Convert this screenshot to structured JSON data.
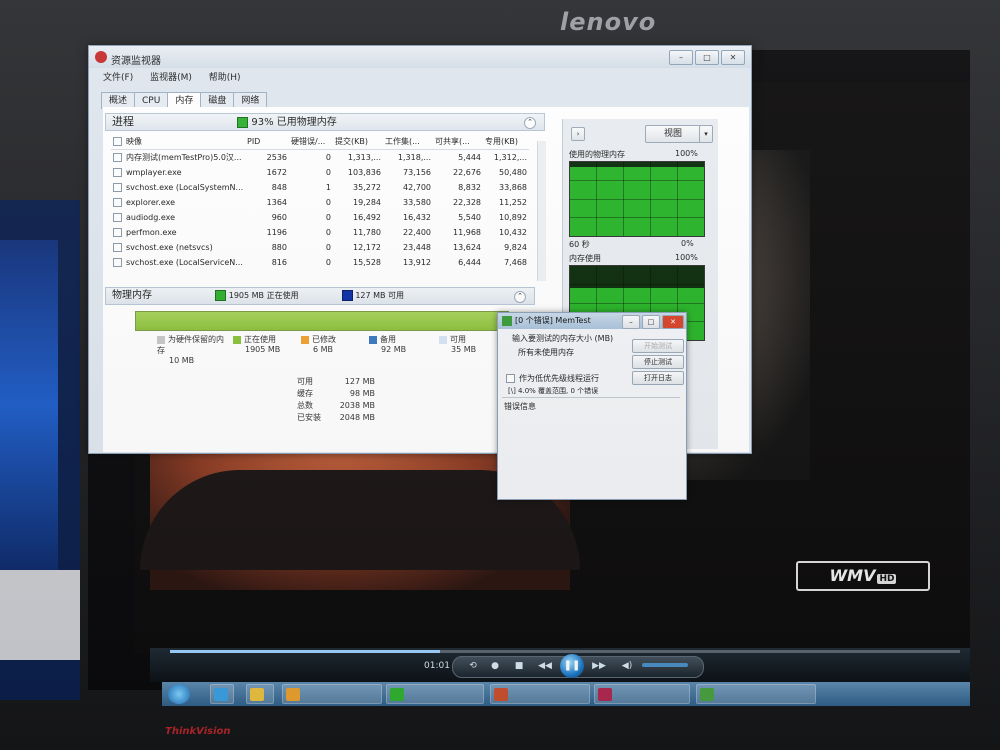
{
  "monitor": {
    "brand": "lenovo",
    "model": "ThinkVision"
  },
  "resmon": {
    "title": "资源监视器",
    "menu": [
      "文件(F)",
      "监视器(M)",
      "帮助(H)"
    ],
    "tabs": [
      "概述",
      "CPU",
      "内存",
      "磁盘",
      "网络"
    ],
    "active_tab": "内存",
    "process_section": {
      "title": "进程",
      "summary": "93% 已用物理内存",
      "columns": [
        "映像",
        "PID",
        "硬错误/...",
        "提交(KB)",
        "工作集(...",
        "可共享(...",
        "专用(KB)"
      ],
      "rows": [
        [
          "内存测试(memTestPro)5.0汉...",
          "2536",
          "0",
          "1,313,...",
          "1,318,...",
          "5,444",
          "1,312,..."
        ],
        [
          "wmplayer.exe",
          "1672",
          "0",
          "103,836",
          "73,156",
          "22,676",
          "50,480"
        ],
        [
          "svchost.exe (LocalSystemN...",
          "848",
          "1",
          "35,272",
          "42,700",
          "8,832",
          "33,868"
        ],
        [
          "explorer.exe",
          "1364",
          "0",
          "19,284",
          "33,580",
          "22,328",
          "11,252"
        ],
        [
          "audiodg.exe",
          "960",
          "0",
          "16,492",
          "16,432",
          "5,540",
          "10,892"
        ],
        [
          "perfmon.exe",
          "1196",
          "0",
          "11,780",
          "22,400",
          "11,968",
          "10,432"
        ],
        [
          "svchost.exe (netsvcs)",
          "880",
          "0",
          "12,172",
          "23,448",
          "13,624",
          "9,824"
        ],
        [
          "svchost.exe (LocalServiceN...",
          "816",
          "0",
          "15,528",
          "13,912",
          "6,444",
          "7,468"
        ]
      ]
    },
    "physical_section": {
      "title": "物理内存",
      "in_use": "1905 MB 正在使用",
      "available": "127 MB 可用",
      "legend": [
        {
          "label": "为硬件保留的内存",
          "value": "10 MB",
          "color": "#c8c8c8"
        },
        {
          "label": "正在使用",
          "value": "1905 MB",
          "color": "#8bc03a"
        },
        {
          "label": "已修改",
          "value": "6 MB",
          "color": "#f0a030"
        },
        {
          "label": "备用",
          "value": "92 MB",
          "color": "#3a78c0"
        },
        {
          "label": "可用",
          "value": "35 MB",
          "color": "#d8e4f4"
        }
      ],
      "stats": [
        {
          "label": "可用",
          "value": "127 MB"
        },
        {
          "label": "缓存",
          "value": "98 MB"
        },
        {
          "label": "总数",
          "value": "2038 MB"
        },
        {
          "label": "已安装",
          "value": "2048 MB"
        }
      ]
    },
    "side_panel": {
      "view_label": "视图",
      "graph1_title": "使用的物理内存",
      "graph1_max": "100%",
      "graph1_time": "60 秒",
      "graph1_min": "0%",
      "graph2_title": "内存使用",
      "graph2_max": "100%"
    }
  },
  "memtest": {
    "title": "[0 个错误] MemTest",
    "prompt": "输入要测试的内存大小 (MB)",
    "value": "所有未使用内存",
    "btn_start": "开始测试",
    "btn_stop": "停止测试",
    "btn_log": "打开日志",
    "low_priority": "作为低优先级线程运行",
    "progress": "[\\]  4.0% 覆盖范围, 0 个错误",
    "error_label": "错误信息"
  },
  "player": {
    "time": "01:01",
    "badge": "WMV",
    "badge_sub": "HD"
  },
  "colors": {
    "accent": "#8bc03a",
    "graph": "#27b427"
  }
}
